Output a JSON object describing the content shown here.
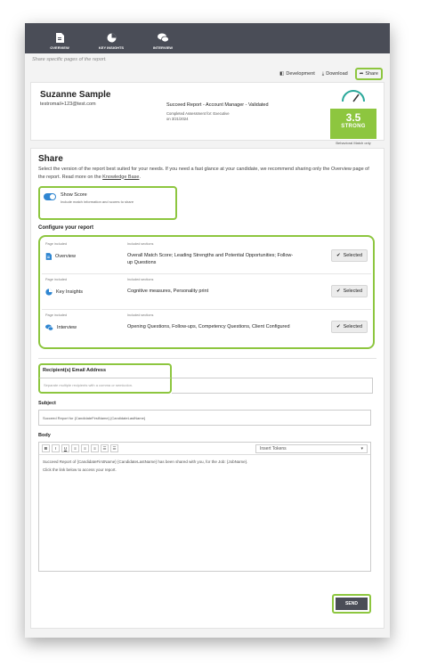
{
  "nav": {
    "items": [
      {
        "label": "OVERVIEW",
        "icon": "document-icon"
      },
      {
        "label": "KEY INSIGHTS",
        "icon": "pie-chart-icon"
      },
      {
        "label": "INTERVIEW",
        "icon": "chat-bubbles-icon"
      }
    ]
  },
  "caption": "Share specific pages of the report.",
  "toolbar": {
    "development_label": "Development",
    "download_label": "Download",
    "share_label": "Share"
  },
  "candidate": {
    "name": "Suzanne Sample",
    "email": "testromail+123@test.com",
    "report_title": "Succeed Report - Account Manager - Validated",
    "completed_label": "Completed Assessment for: Executive",
    "completed_date": "on 3/21/2024",
    "score": "3.5",
    "score_band": "STRONG",
    "score_label": "Behavioral Match only"
  },
  "share": {
    "heading": "Share",
    "description_pre": "Select the version of the report best suited for your needs. If you need a fast glance at your candidate, we recommend sharing only the Overview page of the report. Read more on the ",
    "description_link": "Knowledge Base",
    "description_post": ".",
    "show_score": {
      "title": "Show Score",
      "subtitle": "Include match information and scores to share",
      "enabled": true
    },
    "configure_heading": "Configure your report",
    "page_included_label": "Page included",
    "sections_label": "Included sections",
    "rows": [
      {
        "page": "Overview",
        "icon": "document-icon",
        "sections": "Overall Match Score; Leading Strengths and Potential Opportunities; Follow-up Questions",
        "button": "Selected"
      },
      {
        "page": "Key Insights",
        "icon": "pie-chart-icon",
        "sections": "Cognitive measures, Personality print",
        "button": "Selected"
      },
      {
        "page": "Interview",
        "icon": "chat-bubbles-icon",
        "sections": "Opening Questions, Follow-ups, Competency Questions, Client Configured",
        "button": "Selected"
      }
    ],
    "recipients_label": "Recipient(s) Email Address",
    "recipients_placeholder": "Separate multiple recipients with a comma or semicolon.",
    "subject_label": "Subject",
    "subject_value": "Succeed Report for {CandidateFirstName} {CandidateLastName}",
    "body_label": "Body",
    "editor_buttons": [
      "B",
      "I",
      "U",
      "≡",
      "≡",
      "≡",
      "☰",
      "☰"
    ],
    "insert_tokens_label": "Insert Tokens",
    "body_line1": "Succeed Report of {CandidateFirstName} {CandidateLastName} has been shared with you, for the Job: {JobName}.",
    "body_line2": "Click the link below to access your report.",
    "send_label": "SEND"
  },
  "colors": {
    "accent_green": "#8dc63f",
    "nav_bg": "#4a4d57",
    "toggle_blue": "#2f86d1"
  }
}
